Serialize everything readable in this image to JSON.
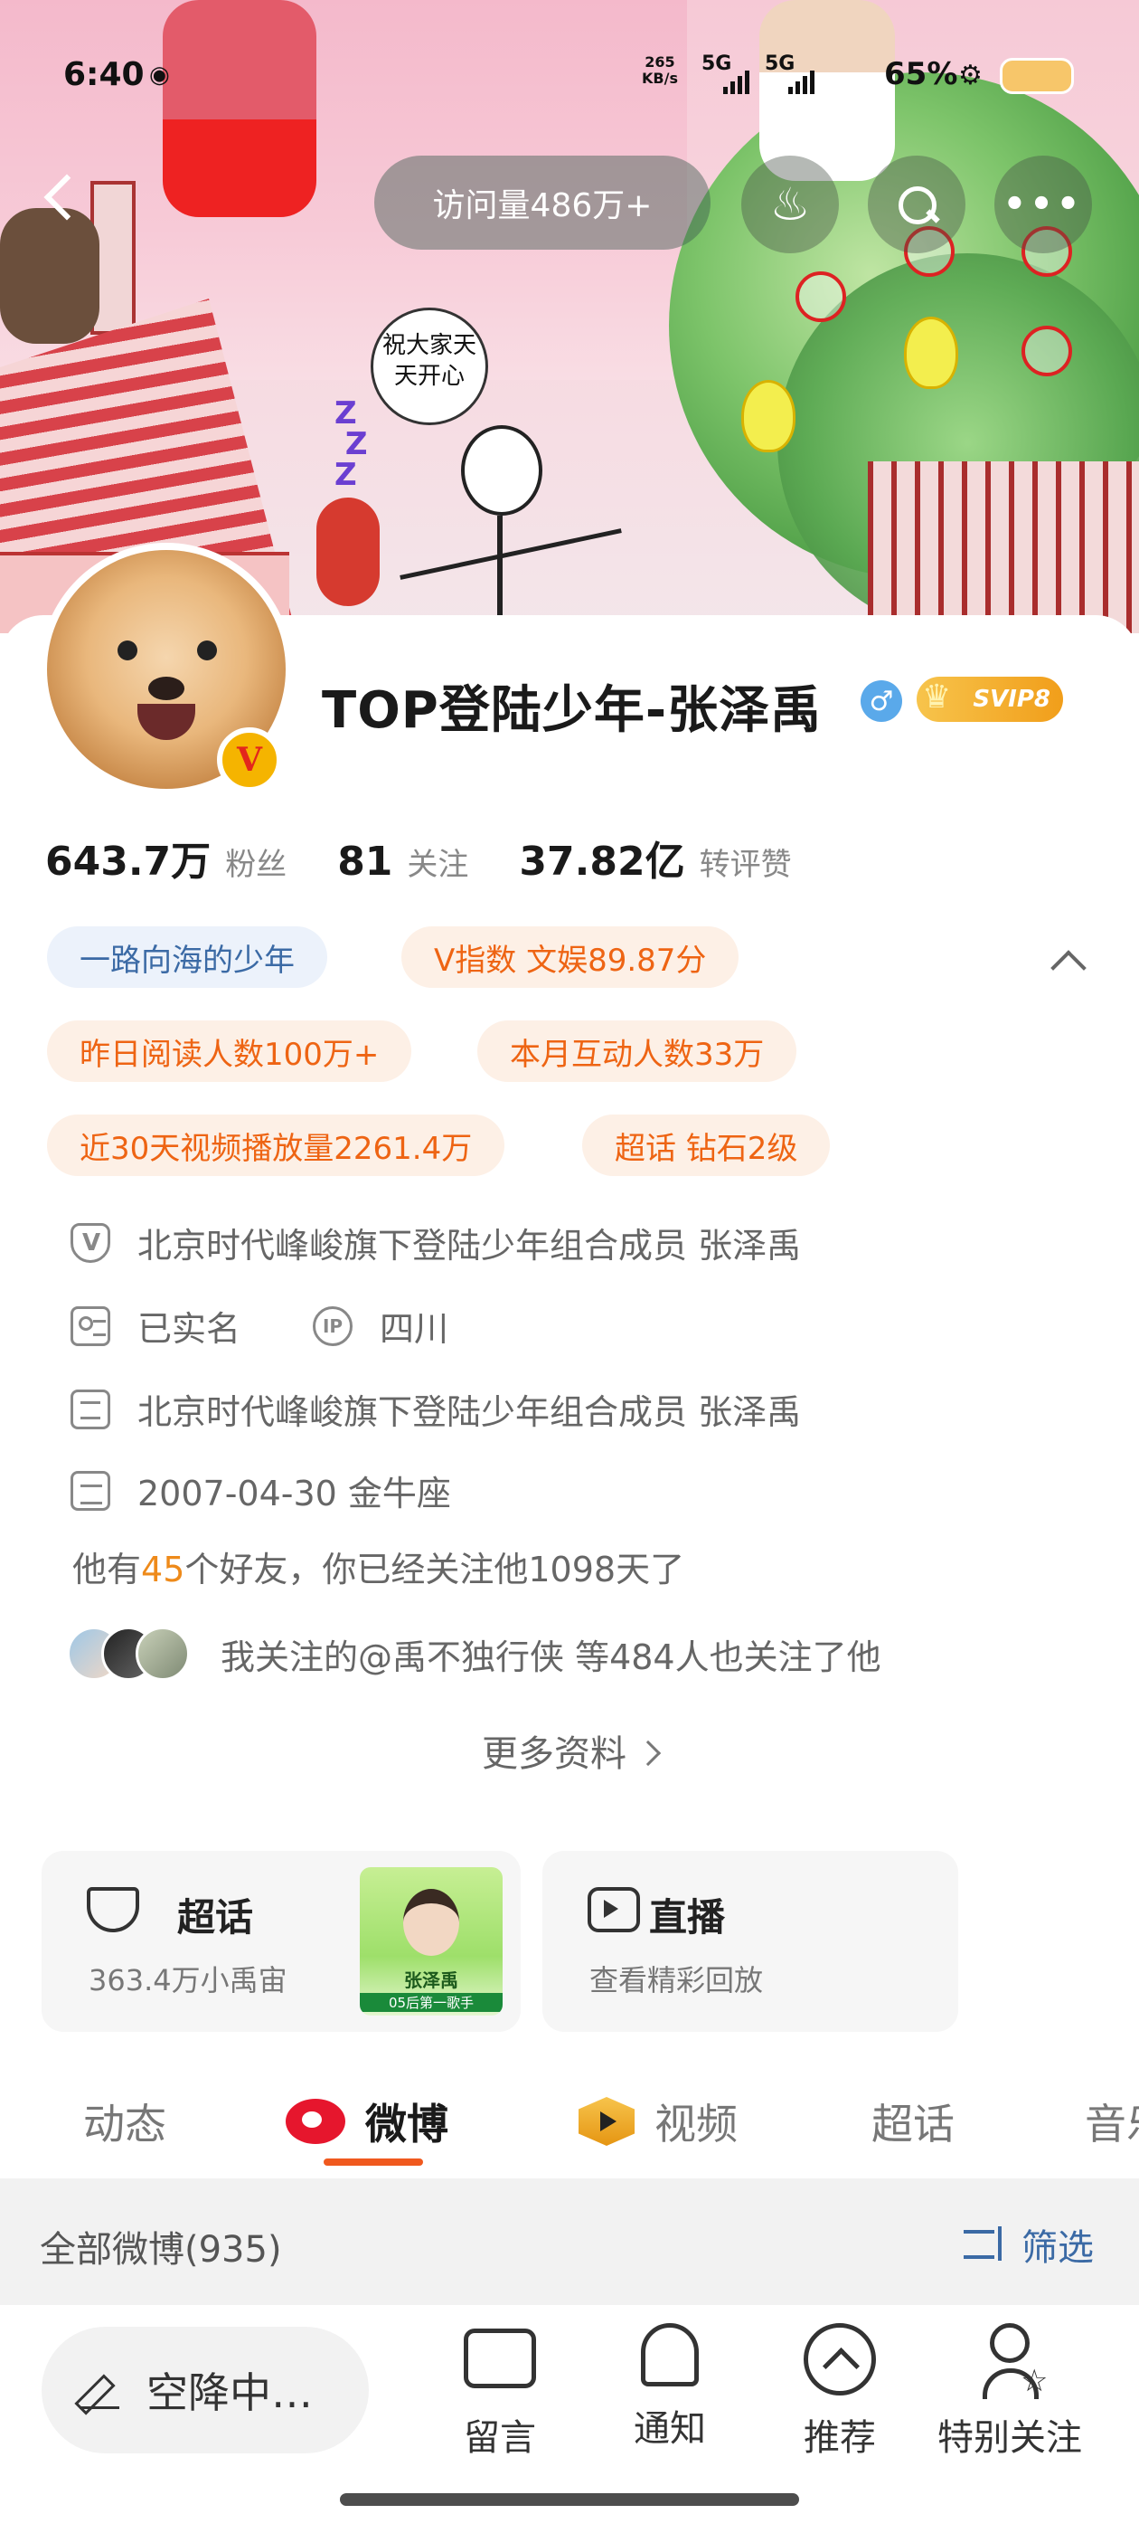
{
  "status_bar": {
    "time": "6:40",
    "net_speed_value": "265",
    "net_speed_unit": "KB/s",
    "sim1": "5G",
    "sim2": "5G",
    "battery": "65%"
  },
  "cover": {
    "speech_bubble": "祝大家天天开心"
  },
  "top_bar": {
    "visits": "访问量486万+"
  },
  "profile": {
    "name": "TOP登陆少年-张泽禹",
    "gender_symbol": "♂",
    "vip_badge": "SVIP8",
    "verified_mark": "V",
    "stats": [
      {
        "value": "643.7万",
        "label": "粉丝"
      },
      {
        "value": "81",
        "label": "关注"
      },
      {
        "value": "37.82亿",
        "label": "转评赞"
      }
    ],
    "tags": [
      "一路向海的少年",
      "V指数 文娱89.87分",
      "昨日阅读人数100万+",
      "本月互动人数33万",
      "近30天视频播放量2261.4万",
      "超话 钻石2级"
    ],
    "verification": "北京时代峰峻旗下登陆少年组合成员 张泽禹",
    "real_name": "已实名",
    "ip_label": "IP",
    "ip_location": "四川",
    "bio": "北京时代峰峻旗下登陆少年组合成员 张泽禹",
    "birthday": "2007-04-30 金牛座",
    "friends_prefix": "他有",
    "friends_count": "45",
    "friends_suffix": "个好友，你已经关注他1098天了",
    "mutual_follow": "我关注的@禹不独行侠 等484人也关注了他",
    "more_info": "更多资料"
  },
  "feature_cards": {
    "super_topic": {
      "title": "超话",
      "subtitle": "363.4万小禹宙",
      "thumb_caption": "张泽禹",
      "thumb_subcaption": "05后第一歌手"
    },
    "live": {
      "title": "直播",
      "subtitle": "查看精彩回放"
    }
  },
  "tabs": [
    "动态",
    "微博",
    "视频",
    "超话",
    "音乐"
  ],
  "active_tab": "微博",
  "filter_bar": {
    "all_posts": "全部微博(935)",
    "filter": "筛选"
  },
  "bottom_bar": {
    "compose": "空降中…",
    "items": [
      "留言",
      "通知",
      "推荐",
      "特别关注"
    ]
  }
}
